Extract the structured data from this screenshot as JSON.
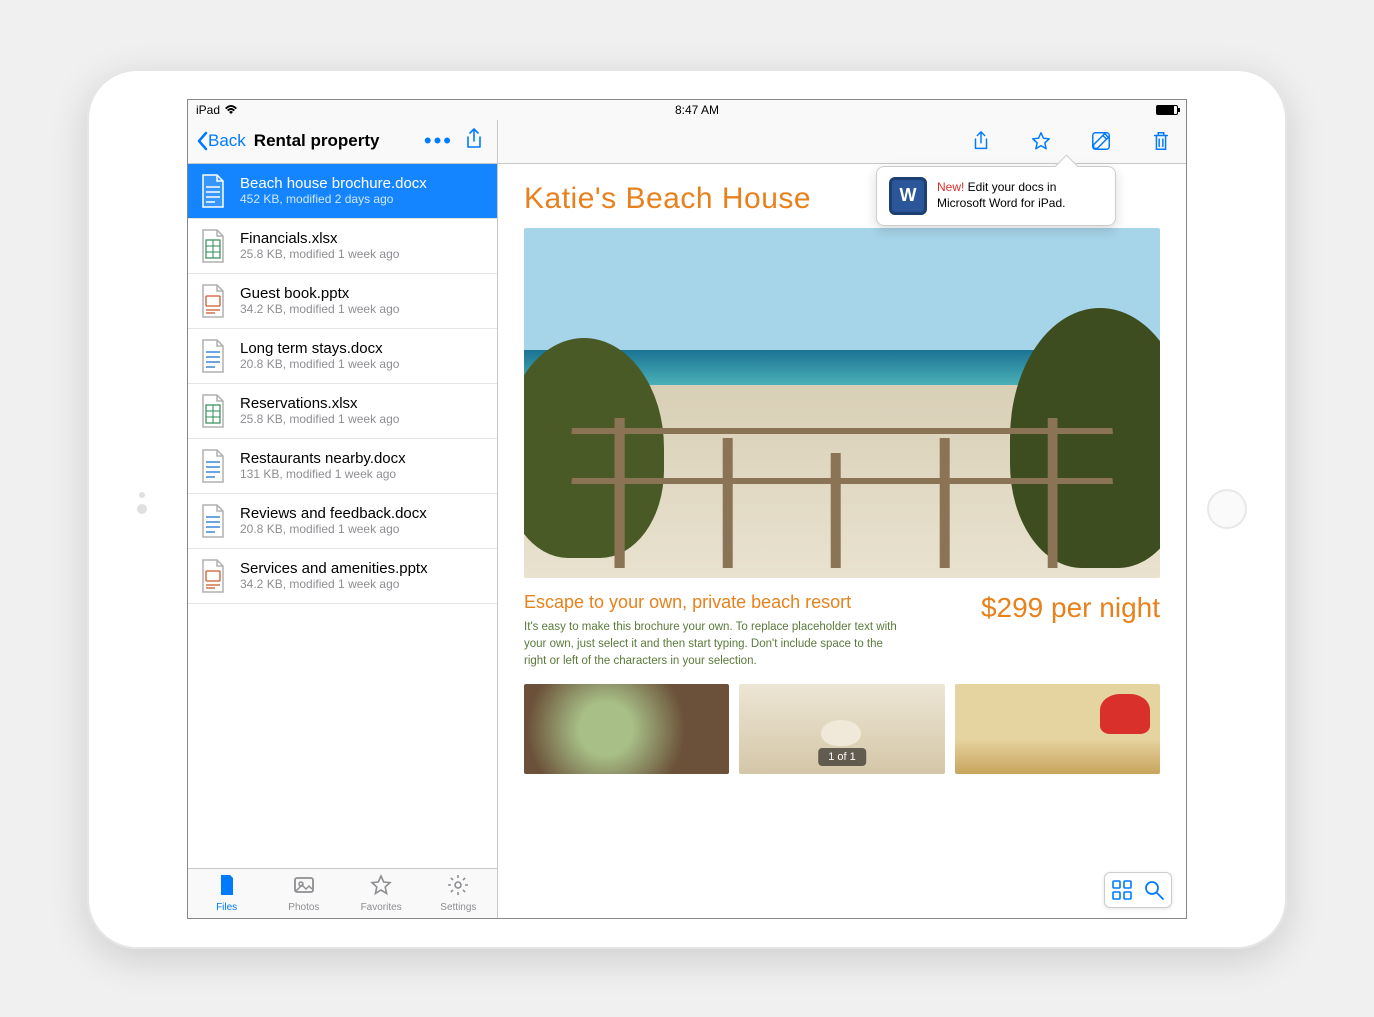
{
  "statusbar": {
    "device": "iPad",
    "time": "8:47 AM"
  },
  "sidebar": {
    "back_label": "Back",
    "title": "Rental property",
    "files": [
      {
        "name": "Beach house brochure.docx",
        "meta": "452 KB, modified 2 days ago",
        "type": "docx",
        "selected": true
      },
      {
        "name": "Financials.xlsx",
        "meta": "25.8 KB, modified 1 week ago",
        "type": "xlsx"
      },
      {
        "name": "Guest book.pptx",
        "meta": "34.2 KB, modified 1 week ago",
        "type": "pptx"
      },
      {
        "name": "Long term stays.docx",
        "meta": "20.8 KB, modified 1 week ago",
        "type": "docx"
      },
      {
        "name": "Reservations.xlsx",
        "meta": "25.8 KB, modified 1 week ago",
        "type": "xlsx"
      },
      {
        "name": "Restaurants nearby.docx",
        "meta": "131 KB, modified 1 week ago",
        "type": "docx"
      },
      {
        "name": "Reviews and feedback.docx",
        "meta": "20.8 KB, modified 1 week ago",
        "type": "docx"
      },
      {
        "name": "Services and amenities.pptx",
        "meta": "34.2 KB, modified 1 week ago",
        "type": "pptx"
      }
    ],
    "tabs": [
      {
        "label": "Files",
        "active": true
      },
      {
        "label": "Photos"
      },
      {
        "label": "Favorites"
      },
      {
        "label": "Settings"
      }
    ]
  },
  "popover": {
    "new_label": "New!",
    "text": " Edit your docs in Microsoft Word for iPad."
  },
  "document": {
    "title": "Katie's Beach House",
    "subtitle": "Escape to your own, private beach resort",
    "body": "It's easy to make this brochure your own. To replace placeholder text with your own, just select it and then start typing. Don't include space to the right or left of the characters in your selection.",
    "price": "$299 per night",
    "page_indicator": "1 of 1"
  }
}
